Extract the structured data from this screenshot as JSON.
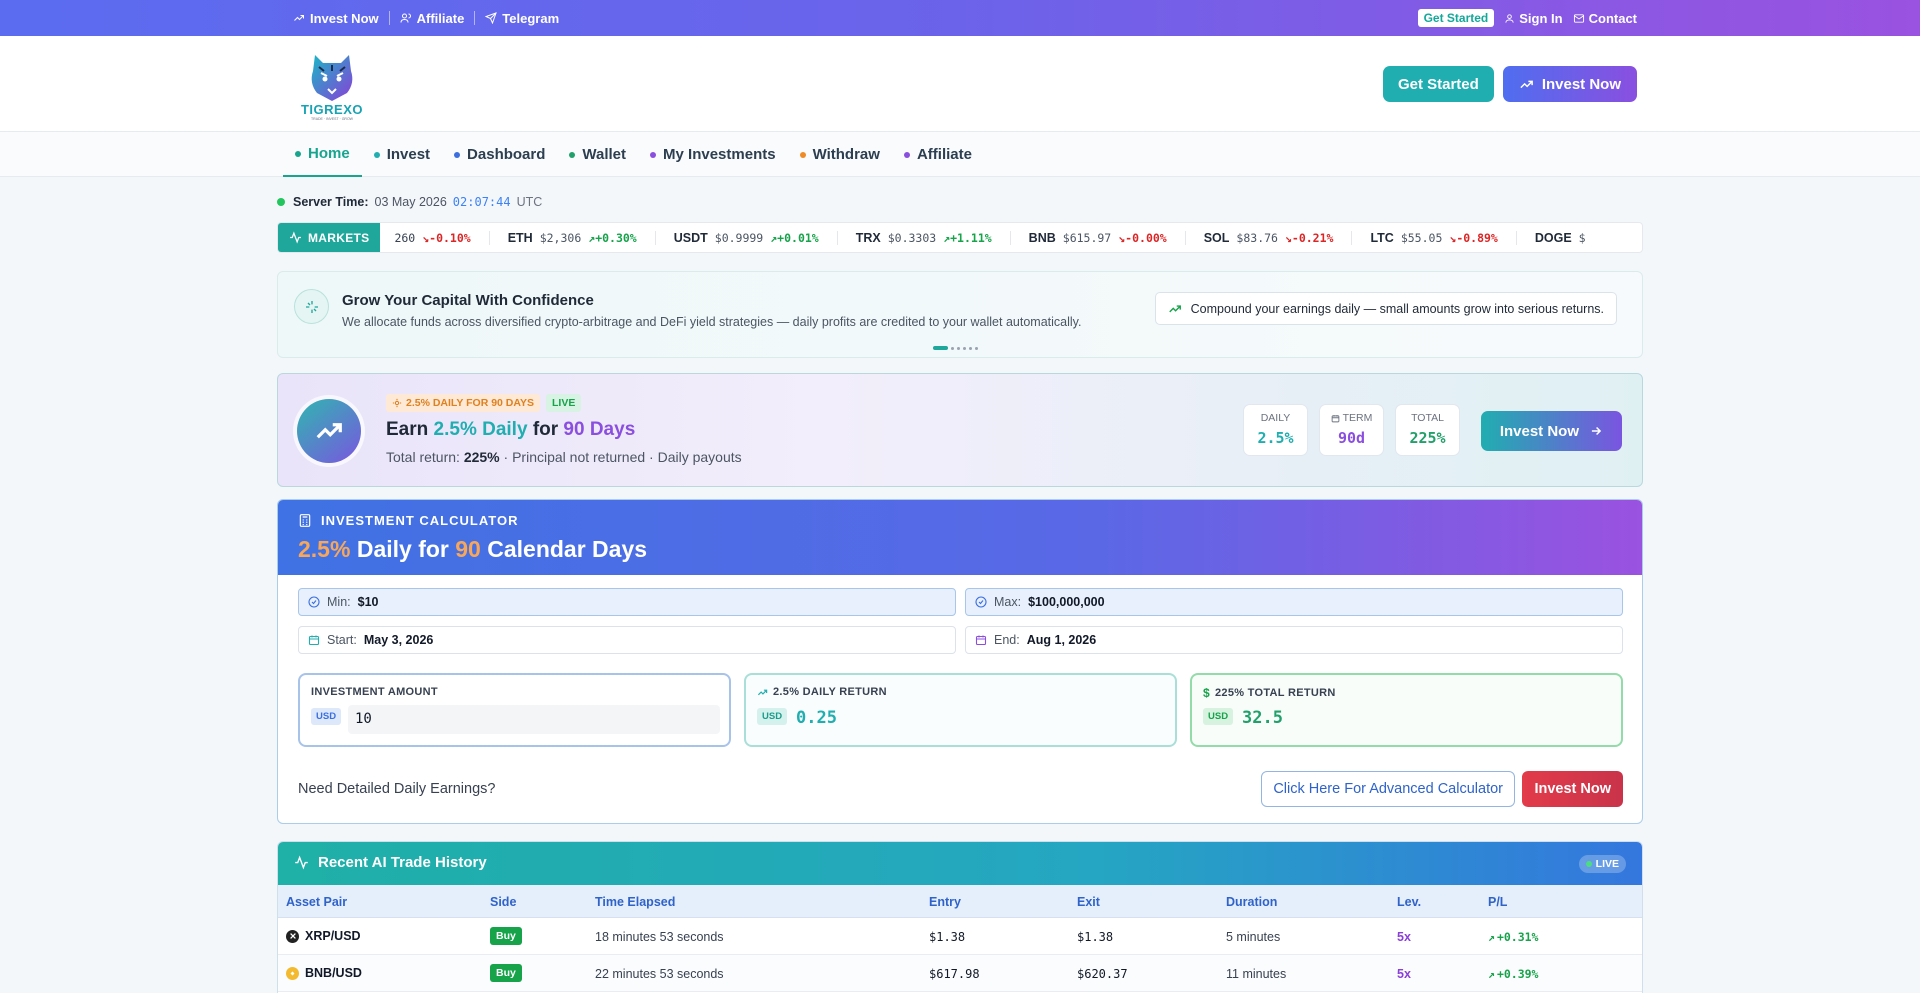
{
  "topbar": {
    "left_links": [
      "Invest Now",
      "Affiliate",
      "Telegram"
    ],
    "get_started": "Get Started",
    "sign_in": "Sign In",
    "contact": "Contact"
  },
  "header": {
    "logo_text": "TIGREXO",
    "logo_tagline": "TRADE · INVEST · GROW",
    "get_started": "Get Started",
    "invest_now": "Invest Now"
  },
  "nav": {
    "items": [
      {
        "label": "Home",
        "color": "#17a58f"
      },
      {
        "label": "Invest",
        "color": "#20aeb0"
      },
      {
        "label": "Dashboard",
        "color": "#3b6fe0"
      },
      {
        "label": "Wallet",
        "color": "#22a06b"
      },
      {
        "label": "My Investments",
        "color": "#8b4fe0"
      },
      {
        "label": "Withdraw",
        "color": "#f08a24"
      },
      {
        "label": "Affiliate",
        "color": "#8b4fe0"
      }
    ]
  },
  "server": {
    "label": "Server Time:",
    "date": "03 May 2026",
    "time": "02:07:44",
    "tz": "UTC"
  },
  "markets": {
    "label": "MARKETS",
    "partial": {
      "price": "260",
      "change": "-0.10%",
      "dir": "dn"
    },
    "tickers": [
      {
        "sym": "ETH",
        "price": "$2,306",
        "change": "+0.30%",
        "dir": "up"
      },
      {
        "sym": "USDT",
        "price": "$0.9999",
        "change": "+0.01%",
        "dir": "up"
      },
      {
        "sym": "TRX",
        "price": "$0.3303",
        "change": "+1.11%",
        "dir": "up"
      },
      {
        "sym": "BNB",
        "price": "$615.97",
        "change": "-0.00%",
        "dir": "dn"
      },
      {
        "sym": "SOL",
        "price": "$83.76",
        "change": "-0.21%",
        "dir": "dn"
      },
      {
        "sym": "LTC",
        "price": "$55.05",
        "change": "-0.89%",
        "dir": "dn"
      },
      {
        "sym": "DOGE",
        "price": "$",
        "change": "",
        "dir": "up"
      }
    ]
  },
  "promo": {
    "title": "Grow Your Capital With Confidence",
    "subtitle": "We allocate funds across diversified crypto-arbitrage and DeFi yield strategies — daily profits are credited to your wallet automatically.",
    "pill": "Compound your earnings daily — small amounts grow into serious returns."
  },
  "plan": {
    "tag": "2.5% DAILY FOR 90 DAYS",
    "live": "LIVE",
    "h_pre": "Earn",
    "h_rate": "2.5% Daily",
    "h_mid": "for",
    "h_days": "90 Days",
    "sub_pre": "Total return:",
    "sub_val": "225%",
    "sub_post": "· Principal not returned · Daily payouts",
    "stats": [
      {
        "label": "DAILY",
        "value": "2.5%",
        "color": "#20aeb0"
      },
      {
        "label": "TERM",
        "value": "90d",
        "color": "#8b4fe0"
      },
      {
        "label": "TOTAL",
        "value": "225%",
        "color": "#22a06b"
      }
    ],
    "cta": "Invest Now"
  },
  "calc": {
    "caption": "INVESTMENT CALCULATOR",
    "title_rate": "2.5%",
    "title_mid": "Daily for",
    "title_days": "90",
    "title_post": "Calendar Days",
    "min_label": "Min:",
    "min_val": "$10",
    "max_label": "Max:",
    "max_val": "$100,000,000",
    "start_label": "Start:",
    "start_val": "May 3, 2026",
    "end_label": "End:",
    "end_val": "Aug 1, 2026",
    "amount_label": "INVESTMENT AMOUNT",
    "amount_value": "10",
    "daily_label": "2.5% DAILY RETURN",
    "daily_value": "0.25",
    "total_label": "225% TOTAL RETURN",
    "total_value": "32.5",
    "currency": "USD",
    "need": "Need Detailed Daily Earnings?",
    "advanced": "Click Here For Advanced Calculator",
    "invest": "Invest Now"
  },
  "trades": {
    "title": "Recent AI Trade History",
    "live": "LIVE",
    "columns": [
      "Asset Pair",
      "Side",
      "Time Elapsed",
      "Entry",
      "Exit",
      "Duration",
      "Lev.",
      "P/L"
    ],
    "rows": [
      {
        "pair": "XRP/USD",
        "coin_color": "#222222",
        "side": "Buy",
        "elapsed": "18 minutes 53 seconds",
        "entry": "$1.38",
        "exit": "$1.38",
        "duration": "5 minutes",
        "lev": "5x",
        "pl": "+0.31%"
      },
      {
        "pair": "BNB/USD",
        "coin_color": "#f3ba2f",
        "side": "Buy",
        "elapsed": "22 minutes 53 seconds",
        "entry": "$617.98",
        "exit": "$620.37",
        "duration": "11 minutes",
        "lev": "5x",
        "pl": "+0.39%"
      }
    ]
  }
}
